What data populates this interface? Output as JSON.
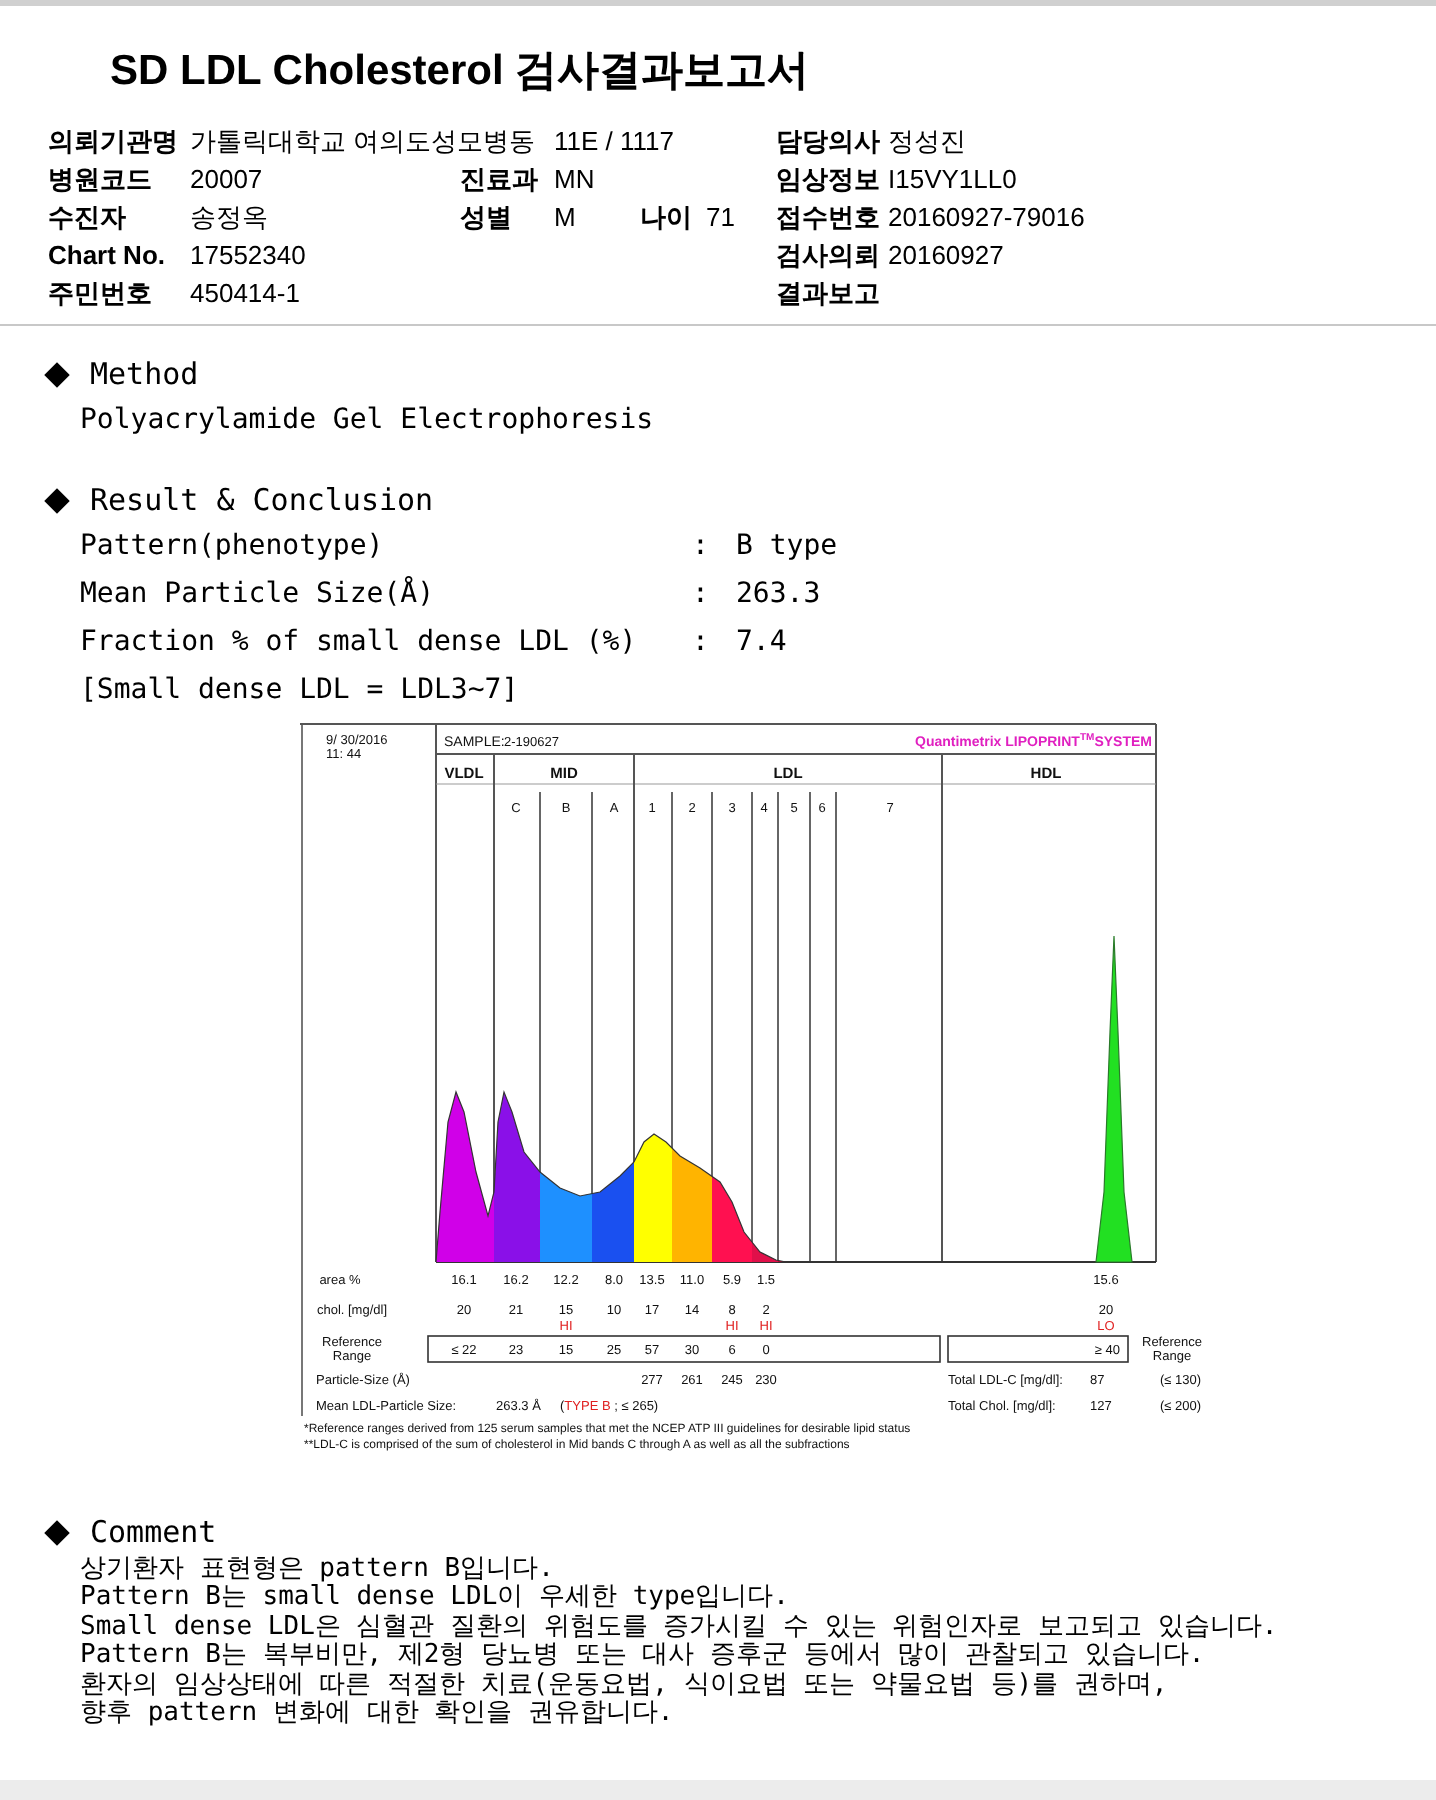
{
  "title": "SD LDL Cholesterol 검사결과보고서",
  "info_rows": [
    {
      "left": {
        "label": "의뢰기관명",
        "value": "가톨릭대학교 여의도성모병동"
      },
      "mid": {
        "value": "11E / 1117"
      },
      "right": {
        "label": "담당의사",
        "value": "정성진"
      }
    },
    {
      "left": {
        "label": "병원코드",
        "value": "20007"
      },
      "mid": {
        "label": "진료과",
        "value": "MN"
      },
      "right": {
        "label": "임상정보",
        "value": "I15VY1LL0"
      }
    },
    {
      "left": {
        "label": "수진자",
        "value": "송정옥"
      },
      "mid": {
        "label": "성별",
        "value": "M"
      },
      "age": {
        "label": "나이",
        "value": "71"
      },
      "right": {
        "label": "접수번호",
        "value": "20160927-79016"
      }
    },
    {
      "left": {
        "label": "Chart No.",
        "value": "17552340"
      },
      "right": {
        "label": "검사의뢰",
        "value": "20160927"
      }
    },
    {
      "left": {
        "label": "주민번호",
        "value": "450414-1"
      },
      "right": {
        "label": "결과보고"
      }
    }
  ],
  "method": {
    "heading": "Method",
    "text": "Polyacrylamide Gel Electrophoresis"
  },
  "result": {
    "heading": "Result & Conclusion",
    "rows": [
      {
        "label": "Pattern(phenotype)",
        "sep": ":",
        "value": "B type"
      },
      {
        "label": "Mean Particle Size(Å)",
        "sep": ":",
        "value": "263.3"
      },
      {
        "label": "Fraction % of small dense LDL (%)",
        "sep": ":",
        "value": "7.4"
      }
    ],
    "note": "[Small dense LDL = LDL3~7]",
    "lipoprint": {
      "date": "9/ 30/2016",
      "time": "11: 44",
      "sample_label": "SAMPLE:",
      "sample": "2-190627",
      "brand": "Quantimetrix LIPOPRINT",
      "brand_mark": "TM",
      "brand_tail": "SYSTEM",
      "bands": [
        "VLDL",
        "MID",
        "LDL",
        "HDL"
      ],
      "subbands": [
        "C",
        "B",
        "A",
        "1",
        "2",
        "3",
        "4",
        "5",
        "6",
        "7"
      ],
      "area_label": "area %",
      "chol_label": "chol. [mg/dl]",
      "ref_label": [
        "Reference",
        "Range"
      ],
      "ref_label_right": [
        "Reference",
        "Range"
      ],
      "columns": [
        {
          "area": "16.1",
          "chol": "20",
          "ref": "≤ 22"
        },
        {
          "area": "16.2",
          "chol": "21",
          "ref": "23"
        },
        {
          "area": "12.2",
          "chol": "15",
          "flag": "HI",
          "ref": "15"
        },
        {
          "area": "8.0",
          "chol": "10",
          "ref": "25"
        },
        {
          "area": "13.5",
          "chol": "17",
          "ref": "57",
          "size": "277"
        },
        {
          "area": "11.0",
          "chol": "14",
          "ref": "30",
          "size": "261"
        },
        {
          "area": "5.9",
          "chol": "8",
          "flag": "HI",
          "ref": "6",
          "size": "245"
        },
        {
          "area": "1.5",
          "chol": "2",
          "flag": "HI",
          "ref": "0",
          "size": "230"
        }
      ],
      "hdl": {
        "area": "15.6",
        "chol": "20",
        "flag": "LO",
        "ref": "≥ 40"
      },
      "size_label": "Particle-Size (Å)",
      "mean": {
        "label": "Mean LDL-Particle Size:",
        "value": "263.3 Å",
        "before": "(",
        "flag": "TYPE B",
        "after": " ; ≤ 265)"
      },
      "totals": [
        {
          "label": "Total LDL-C [mg/dl]:",
          "value": "87",
          "range": "(≤ 130)"
        },
        {
          "label": "Total Chol. [mg/dl]:",
          "value": "127",
          "range": "(≤ 200)"
        }
      ],
      "footnotes": [
        "*Reference ranges derived from 125 serum samples that met the NCEP ATP III guidelines for desirable lipid status",
        "**LDL-C is comprised of the sum of cholesterol in Mid bands C through A as well as all the subfractions"
      ]
    }
  },
  "comment": {
    "heading": "Comment",
    "lines": [
      "상기환자 표현형은 pattern B입니다.",
      "Pattern B는 small dense LDL이 우세한 type입니다.",
      "Small dense LDL은 심혈관 질환의 위험도를 증가시킬 수 있는 위험인자로 보고되고 있습니다.",
      "Pattern B는 복부비만, 제2형 당뇨병 또는 대사 증후군 등에서 많이 관찰되고 있습니다.",
      "환자의 임상상태에 따른 적절한 치료(운동요법, 식이요법 또는 약물요법 등)를 권하며,",
      "향후 pattern 변화에 대한 확인을 권유합니다."
    ]
  }
}
